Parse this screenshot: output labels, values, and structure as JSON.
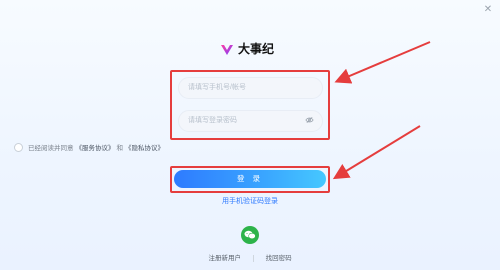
{
  "window": {
    "close_icon": "close-icon"
  },
  "brand": {
    "name": "大事纪",
    "logo_icon": "brand-logo-icon"
  },
  "form": {
    "phone_placeholder": "请填写手机号/帐号",
    "password_placeholder": "请填写登录密码",
    "password_icon": "eye-off-icon"
  },
  "agreement": {
    "prefix": "已经阅读并同意",
    "service": "《服务协议》",
    "and": "和",
    "privacy": "《隐私协议》"
  },
  "actions": {
    "login_label": "登 录",
    "sms_login_label": "用手机验证码登录",
    "wechat_icon": "wechat-icon"
  },
  "footer": {
    "register_label": "注册新用户",
    "forgot_label": "找回密码"
  },
  "annotation": {
    "color": "#e53d3d"
  }
}
